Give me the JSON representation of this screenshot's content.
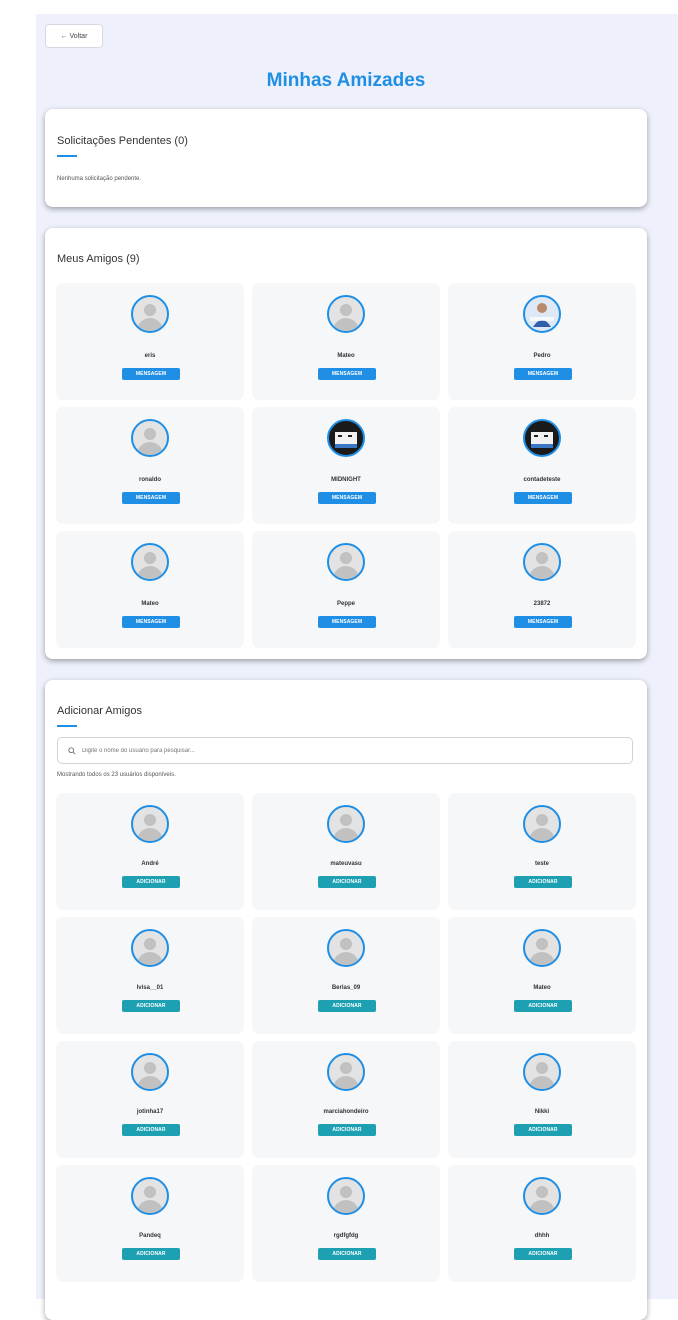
{
  "back_button": {
    "label": "← Voltar"
  },
  "page_title": "Minhas Amizades",
  "pending": {
    "title": "Solicitações Pendentes (0)",
    "empty_text": "Nenhuma solicitação pendente."
  },
  "friends": {
    "title": "Meus Amigos (9)",
    "button_label": "MENSAGEM",
    "items": [
      {
        "name": "eris",
        "avatar": "default"
      },
      {
        "name": "Mateo",
        "avatar": "default"
      },
      {
        "name": "Pedro",
        "avatar": "photo"
      },
      {
        "name": "ronaldo",
        "avatar": "default"
      },
      {
        "name": "MIDNIGHT",
        "avatar": "photo-dark"
      },
      {
        "name": "contadeteste",
        "avatar": "photo-dark"
      },
      {
        "name": "Mateo",
        "avatar": "default"
      },
      {
        "name": "Peppe",
        "avatar": "default"
      },
      {
        "name": "23872",
        "avatar": "default"
      }
    ]
  },
  "add_friends": {
    "title": "Adicionar Amigos",
    "search_placeholder": "Digite o nome do usuário para pesquisar...",
    "showing_text": "Mostrando todos os 23 usuários disponíveis.",
    "button_label": "ADICIONAR",
    "items": [
      {
        "name": "André"
      },
      {
        "name": "mateuvasu"
      },
      {
        "name": "teste"
      },
      {
        "name": "lvisa__01"
      },
      {
        "name": "Berlas_09"
      },
      {
        "name": "Mateo"
      },
      {
        "name": "jotinha17"
      },
      {
        "name": "marciahondeiro"
      },
      {
        "name": "Nikki"
      },
      {
        "name": "Pandeq"
      },
      {
        "name": "rgdfgfdg"
      },
      {
        "name": "dhhh"
      }
    ]
  },
  "colors": {
    "accent": "#1f8fe6",
    "add_button": "#1ea0b3",
    "background": "#eef1fb"
  }
}
